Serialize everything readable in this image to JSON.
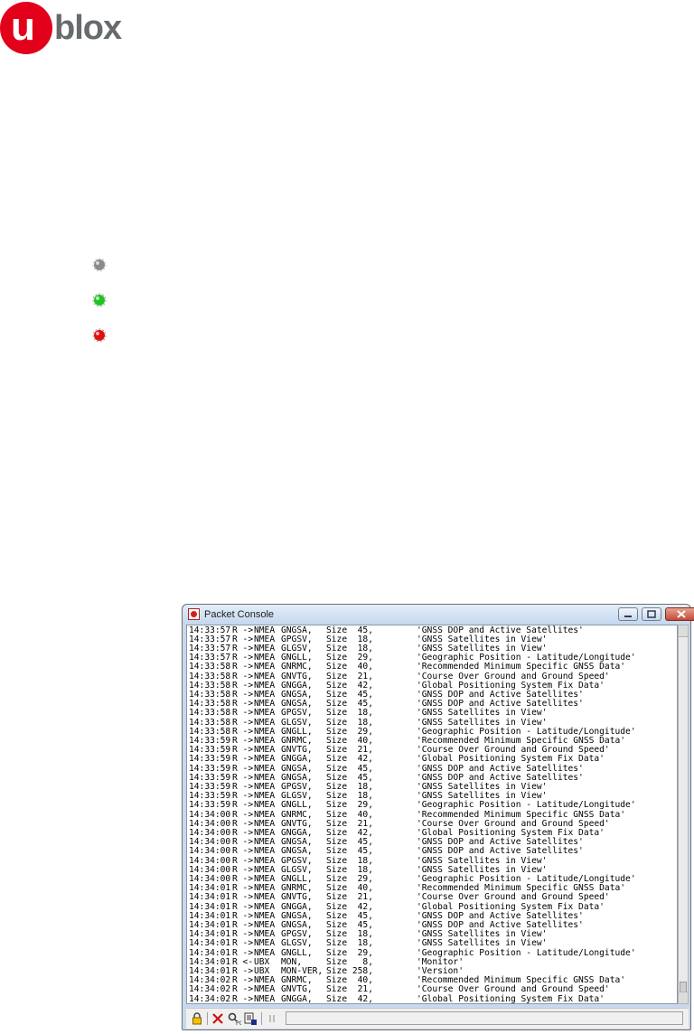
{
  "logo": {
    "u": "u",
    "rest": "blox"
  },
  "status_leds": [
    {
      "name": "gray-led-icon",
      "color": "#8a8a8a"
    },
    {
      "name": "green-led-icon",
      "color": "#21c321"
    },
    {
      "name": "red-led-icon",
      "color": "#e01010"
    }
  ],
  "window": {
    "title": "Packet Console",
    "console_lines": [
      {
        "time": "14:33:57",
        "dir": "R ->",
        "proto": "NMEA",
        "msg": "GNGSA,",
        "size": "Size  45,",
        "desc": "'GNSS DOP and Active Satellites'"
      },
      {
        "time": "14:33:57",
        "dir": "R ->",
        "proto": "NMEA",
        "msg": "GPGSV,",
        "size": "Size  18,",
        "desc": "'GNSS Satellites in View'"
      },
      {
        "time": "14:33:57",
        "dir": "R ->",
        "proto": "NMEA",
        "msg": "GLGSV,",
        "size": "Size  18,",
        "desc": "'GNSS Satellites in View'"
      },
      {
        "time": "14:33:57",
        "dir": "R ->",
        "proto": "NMEA",
        "msg": "GNGLL,",
        "size": "Size  29,",
        "desc": "'Geographic Position - Latitude/Longitude'"
      },
      {
        "time": "14:33:58",
        "dir": "R ->",
        "proto": "NMEA",
        "msg": "GNRMC,",
        "size": "Size  40,",
        "desc": "'Recommended Minimum Specific GNSS Data'"
      },
      {
        "time": "14:33:58",
        "dir": "R ->",
        "proto": "NMEA",
        "msg": "GNVTG,",
        "size": "Size  21,",
        "desc": "'Course Over Ground and Ground Speed'"
      },
      {
        "time": "14:33:58",
        "dir": "R ->",
        "proto": "NMEA",
        "msg": "GNGGA,",
        "size": "Size  42,",
        "desc": "'Global Positioning System Fix Data'"
      },
      {
        "time": "14:33:58",
        "dir": "R ->",
        "proto": "NMEA",
        "msg": "GNGSA,",
        "size": "Size  45,",
        "desc": "'GNSS DOP and Active Satellites'"
      },
      {
        "time": "14:33:58",
        "dir": "R ->",
        "proto": "NMEA",
        "msg": "GNGSA,",
        "size": "Size  45,",
        "desc": "'GNSS DOP and Active Satellites'"
      },
      {
        "time": "14:33:58",
        "dir": "R ->",
        "proto": "NMEA",
        "msg": "GPGSV,",
        "size": "Size  18,",
        "desc": "'GNSS Satellites in View'"
      },
      {
        "time": "14:33:58",
        "dir": "R ->",
        "proto": "NMEA",
        "msg": "GLGSV,",
        "size": "Size  18,",
        "desc": "'GNSS Satellites in View'"
      },
      {
        "time": "14:33:58",
        "dir": "R ->",
        "proto": "NMEA",
        "msg": "GNGLL,",
        "size": "Size  29,",
        "desc": "'Geographic Position - Latitude/Longitude'"
      },
      {
        "time": "14:33:59",
        "dir": "R ->",
        "proto": "NMEA",
        "msg": "GNRMC,",
        "size": "Size  40,",
        "desc": "'Recommended Minimum Specific GNSS Data'"
      },
      {
        "time": "14:33:59",
        "dir": "R ->",
        "proto": "NMEA",
        "msg": "GNVTG,",
        "size": "Size  21,",
        "desc": "'Course Over Ground and Ground Speed'"
      },
      {
        "time": "14:33:59",
        "dir": "R ->",
        "proto": "NMEA",
        "msg": "GNGGA,",
        "size": "Size  42,",
        "desc": "'Global Positioning System Fix Data'"
      },
      {
        "time": "14:33:59",
        "dir": "R ->",
        "proto": "NMEA",
        "msg": "GNGSA,",
        "size": "Size  45,",
        "desc": "'GNSS DOP and Active Satellites'"
      },
      {
        "time": "14:33:59",
        "dir": "R ->",
        "proto": "NMEA",
        "msg": "GNGSA,",
        "size": "Size  45,",
        "desc": "'GNSS DOP and Active Satellites'"
      },
      {
        "time": "14:33:59",
        "dir": "R ->",
        "proto": "NMEA",
        "msg": "GPGSV,",
        "size": "Size  18,",
        "desc": "'GNSS Satellites in View'"
      },
      {
        "time": "14:33:59",
        "dir": "R ->",
        "proto": "NMEA",
        "msg": "GLGSV,",
        "size": "Size  18,",
        "desc": "'GNSS Satellites in View'"
      },
      {
        "time": "14:33:59",
        "dir": "R ->",
        "proto": "NMEA",
        "msg": "GNGLL,",
        "size": "Size  29,",
        "desc": "'Geographic Position - Latitude/Longitude'"
      },
      {
        "time": "14:34:00",
        "dir": "R ->",
        "proto": "NMEA",
        "msg": "GNRMC,",
        "size": "Size  40,",
        "desc": "'Recommended Minimum Specific GNSS Data'"
      },
      {
        "time": "14:34:00",
        "dir": "R ->",
        "proto": "NMEA",
        "msg": "GNVTG,",
        "size": "Size  21,",
        "desc": "'Course Over Ground and Ground Speed'"
      },
      {
        "time": "14:34:00",
        "dir": "R ->",
        "proto": "NMEA",
        "msg": "GNGGA,",
        "size": "Size  42,",
        "desc": "'Global Positioning System Fix Data'"
      },
      {
        "time": "14:34:00",
        "dir": "R ->",
        "proto": "NMEA",
        "msg": "GNGSA,",
        "size": "Size  45,",
        "desc": "'GNSS DOP and Active Satellites'"
      },
      {
        "time": "14:34:00",
        "dir": "R ->",
        "proto": "NMEA",
        "msg": "GNGSA,",
        "size": "Size  45,",
        "desc": "'GNSS DOP and Active Satellites'"
      },
      {
        "time": "14:34:00",
        "dir": "R ->",
        "proto": "NMEA",
        "msg": "GPGSV,",
        "size": "Size  18,",
        "desc": "'GNSS Satellites in View'"
      },
      {
        "time": "14:34:00",
        "dir": "R ->",
        "proto": "NMEA",
        "msg": "GLGSV,",
        "size": "Size  18,",
        "desc": "'GNSS Satellites in View'"
      },
      {
        "time": "14:34:00",
        "dir": "R ->",
        "proto": "NMEA",
        "msg": "GNGLL,",
        "size": "Size  29,",
        "desc": "'Geographic Position - Latitude/Longitude'"
      },
      {
        "time": "14:34:01",
        "dir": "R ->",
        "proto": "NMEA",
        "msg": "GNRMC,",
        "size": "Size  40,",
        "desc": "'Recommended Minimum Specific GNSS Data'"
      },
      {
        "time": "14:34:01",
        "dir": "R ->",
        "proto": "NMEA",
        "msg": "GNVTG,",
        "size": "Size  21,",
        "desc": "'Course Over Ground and Ground Speed'"
      },
      {
        "time": "14:34:01",
        "dir": "R ->",
        "proto": "NMEA",
        "msg": "GNGGA,",
        "size": "Size  42,",
        "desc": "'Global Positioning System Fix Data'"
      },
      {
        "time": "14:34:01",
        "dir": "R ->",
        "proto": "NMEA",
        "msg": "GNGSA,",
        "size": "Size  45,",
        "desc": "'GNSS DOP and Active Satellites'"
      },
      {
        "time": "14:34:01",
        "dir": "R ->",
        "proto": "NMEA",
        "msg": "GNGSA,",
        "size": "Size  45,",
        "desc": "'GNSS DOP and Active Satellites'"
      },
      {
        "time": "14:34:01",
        "dir": "R ->",
        "proto": "NMEA",
        "msg": "GPGSV,",
        "size": "Size  18,",
        "desc": "'GNSS Satellites in View'"
      },
      {
        "time": "14:34:01",
        "dir": "R ->",
        "proto": "NMEA",
        "msg": "GLGSV,",
        "size": "Size  18,",
        "desc": "'GNSS Satellites in View'"
      },
      {
        "time": "14:34:01",
        "dir": "R ->",
        "proto": "NMEA",
        "msg": "GNGLL,",
        "size": "Size  29,",
        "desc": "'Geographic Position - Latitude/Longitude'"
      },
      {
        "time": "14:34:01",
        "dir": "R <-",
        "proto": "UBX",
        "msg": "MON,",
        "size": "Size   8,",
        "desc": "'Monitor'"
      },
      {
        "time": "14:34:01",
        "dir": "R ->",
        "proto": "UBX",
        "msg": "MON-VER,",
        "size": "Size 258,",
        "desc": "'Version'"
      },
      {
        "time": "14:34:02",
        "dir": "R ->",
        "proto": "NMEA",
        "msg": "GNRMC,",
        "size": "Size  40,",
        "desc": "'Recommended Minimum Specific GNSS Data'"
      },
      {
        "time": "14:34:02",
        "dir": "R ->",
        "proto": "NMEA",
        "msg": "GNVTG,",
        "size": "Size  21,",
        "desc": "'Course Over Ground and Ground Speed'"
      },
      {
        "time": "14:34:02",
        "dir": "R ->",
        "proto": "NMEA",
        "msg": "GNGGA,",
        "size": "Size  42,",
        "desc": "'Global Positioning System Fix Data'"
      }
    ],
    "toolbar_icons": [
      "lock-icon",
      "clear-icon",
      "filter-icon",
      "save-log-icon",
      "pause-icon"
    ]
  }
}
